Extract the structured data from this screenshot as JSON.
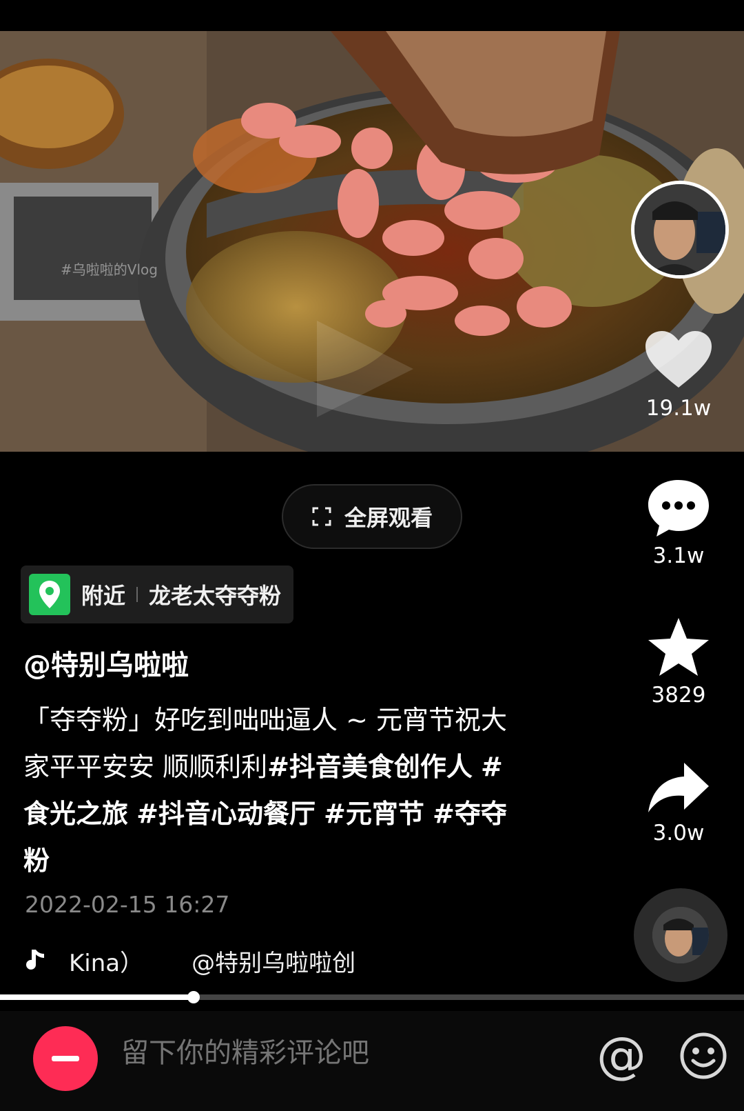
{
  "video": {
    "watermark": "#乌啦啦的Vlog"
  },
  "overlay": {
    "fullscreen_label": "全屏观看"
  },
  "actions": {
    "like_count": "19.1w",
    "comment_count": "3.1w",
    "favorite_count": "3829",
    "share_count": "3.0w"
  },
  "location": {
    "prefix": "附近",
    "place": "龙老太夺夺粉"
  },
  "post": {
    "author": "@特别乌啦啦",
    "description_text": "「夺夺粉」好吃到咄咄逼人 ~ 元宵节祝大家平平安安 顺顺利利",
    "hashtags": [
      "#抖音美食创作人",
      "#食光之旅",
      "#抖音心动餐厅",
      "#元宵节",
      "#夺夺粉"
    ],
    "timestamp": "2022-02-15 16:27"
  },
  "music": {
    "part1": "Kina）",
    "part2": "@特别乌啦啦创"
  },
  "progress": {
    "fraction": 0.26
  },
  "comment_bar": {
    "placeholder": "留下你的精彩评论吧",
    "at_symbol": "@"
  },
  "colors": {
    "accent": "#fe2c55",
    "location_pin": "#23c25a"
  },
  "icons": [
    "fullscreen-icon",
    "heart-icon",
    "comment-icon",
    "star-icon",
    "share-icon",
    "location-pin-icon",
    "music-note-icon",
    "at-icon",
    "emoji-icon"
  ]
}
